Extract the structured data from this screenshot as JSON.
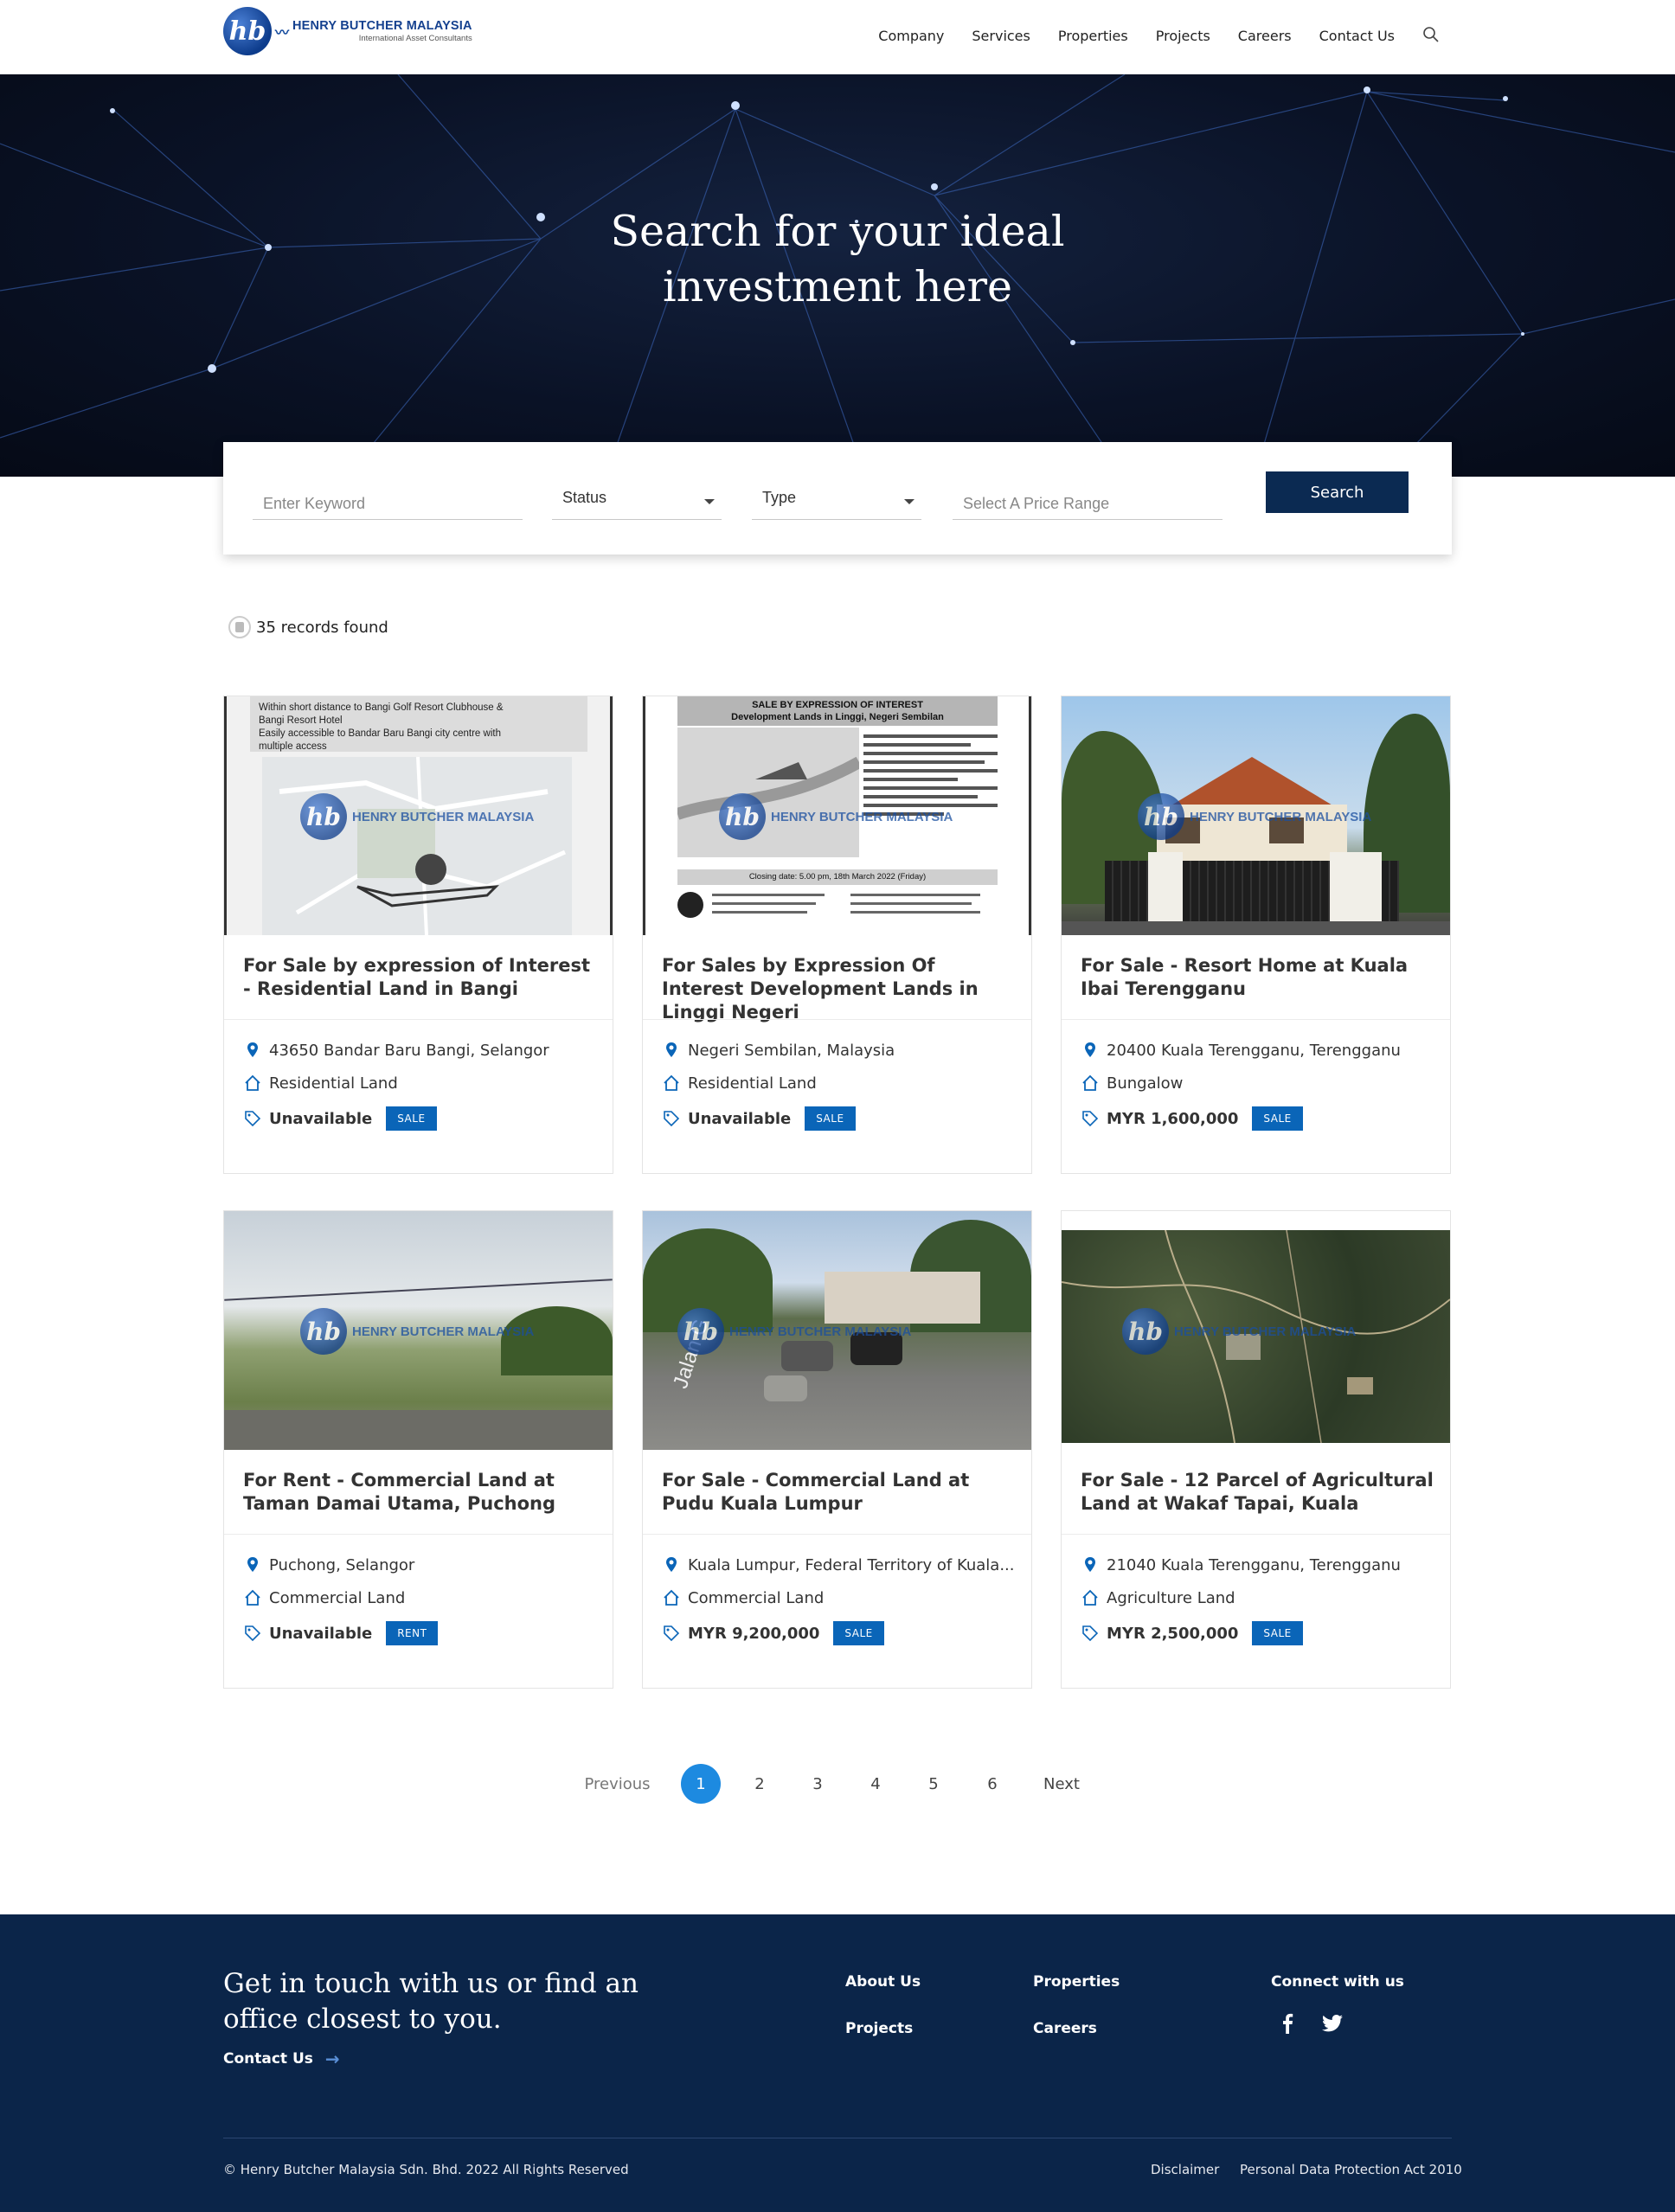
{
  "brand": {
    "logo_mark": "hb",
    "name": "HENRY BUTCHER MALAYSIA",
    "tagline": "International Asset Consultants"
  },
  "nav": {
    "items": [
      "Company",
      "Services",
      "Properties",
      "Projects",
      "Careers",
      "Contact Us"
    ],
    "search_icon": "search-icon"
  },
  "hero": {
    "title_line1": "Search for your ideal",
    "title_line2": "investment here"
  },
  "search": {
    "keyword_placeholder": "Enter Keyword",
    "status_label": "Status",
    "type_label": "Type",
    "price_placeholder": "Select A Price Range",
    "button_label": "Search"
  },
  "results": {
    "count_text": "35 records found"
  },
  "listings": [
    {
      "title": "For Sale by expression of Interest - Residential Land in Bangi",
      "location": "43650 Bandar Baru Bangi, Selangor",
      "property_type": "Residential Land",
      "price": "Unavailable",
      "badge": "SALE"
    },
    {
      "title": "For Sales by Expression Of Interest Development Lands in Linggi Negeri",
      "location": "Negeri Sembilan, Malaysia",
      "property_type": "Residential Land",
      "price": "Unavailable",
      "badge": "SALE"
    },
    {
      "title": "For Sale - Resort Home at Kuala Ibai Terengganu",
      "location": "20400 Kuala Terengganu, Terengganu",
      "property_type": "Bungalow",
      "price": "MYR 1,600,000",
      "badge": "SALE"
    },
    {
      "title": "For Rent - Commercial Land at Taman Damai Utama, Puchong",
      "location": "Puchong, Selangor",
      "property_type": "Commercial Land",
      "price": "Unavailable",
      "badge": "RENT"
    },
    {
      "title": "For Sale - Commercial Land at Pudu Kuala Lumpur",
      "location": "Kuala Lumpur, Federal Territory of Kuala...",
      "property_type": "Commercial Land",
      "price": "MYR 9,200,000",
      "badge": "SALE"
    },
    {
      "title": "For Sale - 12 Parcel of Agricultural Land at Wakaf Tapai, Kuala",
      "location": "21040 Kuala Terengganu, Terengganu",
      "property_type": "Agriculture Land",
      "price": "MYR 2,500,000",
      "badge": "SALE"
    }
  ],
  "card_images": {
    "brochure1_lines": [
      "Within short distance to Bangi Golf Resort Clubhouse &",
      "Bangi Resort Hotel",
      "Easily accessible to Bandar Baru Bangi city centre with",
      "multiple access"
    ],
    "brochure2_header1": "SALE BY EXPRESSION OF INTEREST",
    "brochure2_header2": "Development Lands in Linggi, Negeri Sembilan",
    "brochure2_closing": "Closing date: 5.00 pm, 18th March 2022 (Friday)",
    "street_sign": "Jalan G"
  },
  "pagination": {
    "previous": "Previous",
    "pages": [
      "1",
      "2",
      "3",
      "4",
      "5",
      "6"
    ],
    "active_page": "1",
    "next": "Next"
  },
  "footer": {
    "headline": "Get in touch with us or find an office closest to you.",
    "contact_label": "Contact Us",
    "links_col1": [
      "About Us",
      "Projects"
    ],
    "links_col2": [
      "Properties",
      "Careers"
    ],
    "connect_title": "Connect with us",
    "social": [
      "facebook-icon",
      "twitter-icon"
    ],
    "copyright": "© Henry Butcher Malaysia Sdn. Bhd. 2022 All Rights Reserved",
    "legal_links": [
      "Disclaimer",
      "Personal Data Protection Act 2010"
    ]
  },
  "colors": {
    "hero_bg": "#0a1226",
    "button_navy": "#0b2a52",
    "badge_blue": "#0a65b8",
    "pager_active": "#1d8ae0",
    "footer_bg": "#0b2549"
  }
}
